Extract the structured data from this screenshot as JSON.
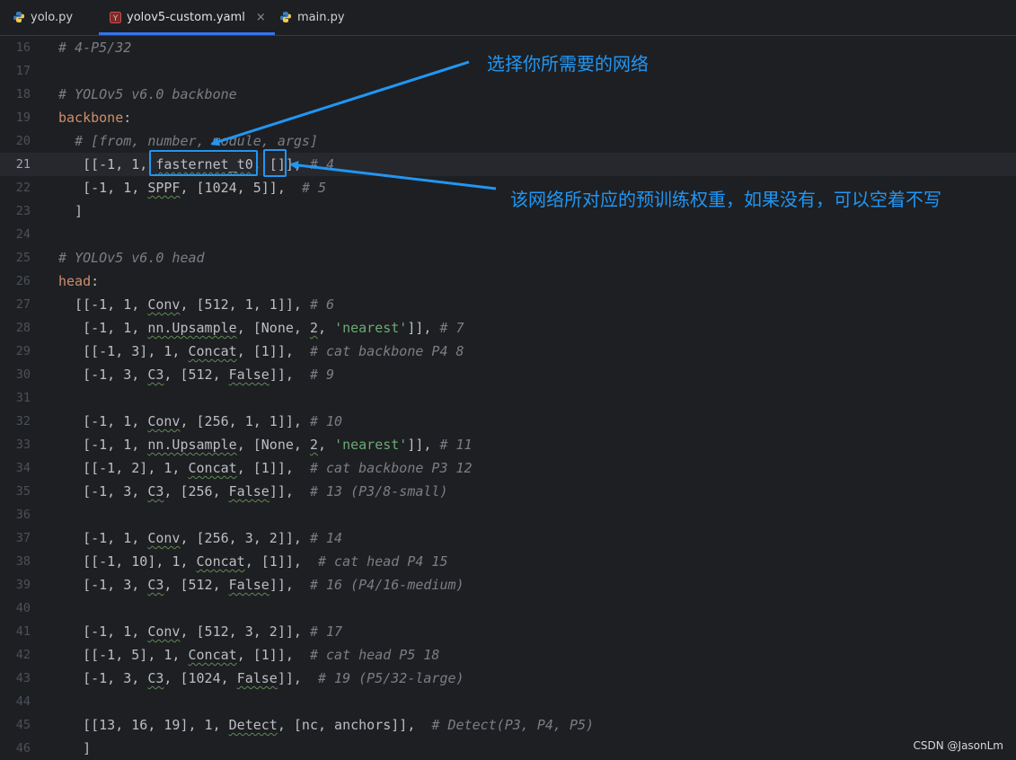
{
  "tabs": [
    {
      "label": "yolo.py",
      "icon": "python-icon"
    },
    {
      "label": "yolov5-custom.yaml",
      "icon": "yaml-icon",
      "active": true,
      "close": "×"
    },
    {
      "label": "main.py",
      "icon": "python-icon"
    }
  ],
  "current_line": 21,
  "lines": [
    {
      "n": "16",
      "t": [
        [
          "cm",
          "# 4-P5/32"
        ]
      ]
    },
    {
      "n": "17",
      "t": []
    },
    {
      "n": "18",
      "t": [
        [
          "cm",
          "# YOLOv5 v6.0 backbone"
        ]
      ]
    },
    {
      "n": "19",
      "t": [
        [
          "key",
          "backbone"
        ],
        [
          "",
          ":"
        ]
      ]
    },
    {
      "n": "20",
      "t": [
        [
          "",
          "  "
        ],
        [
          "cm",
          "# [from, number, module, args]"
        ]
      ]
    },
    {
      "n": "21",
      "t": [
        [
          "",
          "   [[-1, 1, "
        ],
        [
          "sq",
          "fasternet_t0"
        ],
        [
          "",
          ", []], "
        ],
        [
          "cm",
          "# 4"
        ]
      ]
    },
    {
      "n": "22",
      "t": [
        [
          "",
          "   [-1, 1, "
        ],
        [
          "sq",
          "SPPF"
        ],
        [
          "",
          ", [1024, 5]],  "
        ],
        [
          "cm",
          "# 5"
        ]
      ]
    },
    {
      "n": "23",
      "t": [
        [
          "",
          "  ]"
        ]
      ]
    },
    {
      "n": "24",
      "t": []
    },
    {
      "n": "25",
      "t": [
        [
          "cm",
          "# YOLOv5 v6.0 head"
        ]
      ]
    },
    {
      "n": "26",
      "t": [
        [
          "key",
          "head"
        ],
        [
          "",
          ":"
        ]
      ]
    },
    {
      "n": "27",
      "t": [
        [
          "",
          "  [[-1, 1, "
        ],
        [
          "sq",
          "Conv"
        ],
        [
          "",
          ", [512, 1, 1]], "
        ],
        [
          "cm",
          "# 6"
        ]
      ]
    },
    {
      "n": "28",
      "t": [
        [
          "",
          "   [-1, 1, "
        ],
        [
          "sq",
          "nn.Upsample"
        ],
        [
          "",
          ", [None, "
        ],
        [
          "sq",
          "2"
        ],
        [
          "",
          ", "
        ],
        [
          "str",
          "'nearest'"
        ],
        [
          "",
          "]], "
        ],
        [
          "cm",
          "# 7"
        ]
      ]
    },
    {
      "n": "29",
      "t": [
        [
          "",
          "   [[-1, 3], 1, "
        ],
        [
          "sq",
          "Concat"
        ],
        [
          "",
          ", [1]],  "
        ],
        [
          "cm",
          "# cat backbone P4 8"
        ]
      ]
    },
    {
      "n": "30",
      "t": [
        [
          "",
          "   [-1, 3, "
        ],
        [
          "sq",
          "C3"
        ],
        [
          "",
          ", [512, "
        ],
        [
          "sq",
          "False"
        ],
        [
          "",
          "]],  "
        ],
        [
          "cm",
          "# 9"
        ]
      ]
    },
    {
      "n": "31",
      "t": []
    },
    {
      "n": "32",
      "t": [
        [
          "",
          "   [-1, 1, "
        ],
        [
          "sq",
          "Conv"
        ],
        [
          "",
          ", [256, 1, 1]], "
        ],
        [
          "cm",
          "# 10"
        ]
      ]
    },
    {
      "n": "33",
      "t": [
        [
          "",
          "   [-1, 1, "
        ],
        [
          "sq",
          "nn.Upsample"
        ],
        [
          "",
          ", [None, "
        ],
        [
          "sq",
          "2"
        ],
        [
          "",
          ", "
        ],
        [
          "str",
          "'nearest'"
        ],
        [
          "",
          "]], "
        ],
        [
          "cm",
          "# 11"
        ]
      ]
    },
    {
      "n": "34",
      "t": [
        [
          "",
          "   [[-1, 2], 1, "
        ],
        [
          "sq",
          "Concat"
        ],
        [
          "",
          ", [1]],  "
        ],
        [
          "cm",
          "# cat backbone P3 12"
        ]
      ]
    },
    {
      "n": "35",
      "t": [
        [
          "",
          "   [-1, 3, "
        ],
        [
          "sq",
          "C3"
        ],
        [
          "",
          ", [256, "
        ],
        [
          "sq",
          "False"
        ],
        [
          "",
          "]],  "
        ],
        [
          "cm",
          "# 13 (P3/8-small)"
        ]
      ]
    },
    {
      "n": "36",
      "t": []
    },
    {
      "n": "37",
      "t": [
        [
          "",
          "   [-1, 1, "
        ],
        [
          "sq",
          "Conv"
        ],
        [
          "",
          ", [256, 3, 2]], "
        ],
        [
          "cm",
          "# 14"
        ]
      ]
    },
    {
      "n": "38",
      "t": [
        [
          "",
          "   [[-1, 10], 1, "
        ],
        [
          "sq",
          "Concat"
        ],
        [
          "",
          ", [1]],  "
        ],
        [
          "cm",
          "# cat head P4 15"
        ]
      ]
    },
    {
      "n": "39",
      "t": [
        [
          "",
          "   [-1, 3, "
        ],
        [
          "sq",
          "C3"
        ],
        [
          "",
          ", [512, "
        ],
        [
          "sq",
          "False"
        ],
        [
          "",
          "]],  "
        ],
        [
          "cm",
          "# 16 (P4/16-medium)"
        ]
      ]
    },
    {
      "n": "40",
      "t": []
    },
    {
      "n": "41",
      "t": [
        [
          "",
          "   [-1, 1, "
        ],
        [
          "sq",
          "Conv"
        ],
        [
          "",
          ", [512, 3, 2]], "
        ],
        [
          "cm",
          "# 17"
        ]
      ]
    },
    {
      "n": "42",
      "t": [
        [
          "",
          "   [[-1, 5], 1, "
        ],
        [
          "sq",
          "Concat"
        ],
        [
          "",
          ", [1]],  "
        ],
        [
          "cm",
          "# cat head P5 18"
        ]
      ]
    },
    {
      "n": "43",
      "t": [
        [
          "",
          "   [-1, 3, "
        ],
        [
          "sq",
          "C3"
        ],
        [
          "",
          ", [1024, "
        ],
        [
          "sq",
          "False"
        ],
        [
          "",
          "]],  "
        ],
        [
          "cm",
          "# 19 (P5/32-large)"
        ]
      ]
    },
    {
      "n": "44",
      "t": []
    },
    {
      "n": "45",
      "t": [
        [
          "",
          "   [[13, 16, 19], 1, "
        ],
        [
          "sq",
          "Detect"
        ],
        [
          "",
          ", [nc, anchors]],  "
        ],
        [
          "cm",
          "# Detect(P3, P4, P5)"
        ]
      ]
    },
    {
      "n": "46",
      "t": [
        [
          "",
          "   ]"
        ]
      ]
    }
  ],
  "annotations": {
    "network_tip": "选择你所需要的网络",
    "weights_tip": "该网络所对应的预训练权重，如果没有，可以空着不写",
    "color": "#2196f3"
  },
  "watermark": "CSDN @JasonLm"
}
